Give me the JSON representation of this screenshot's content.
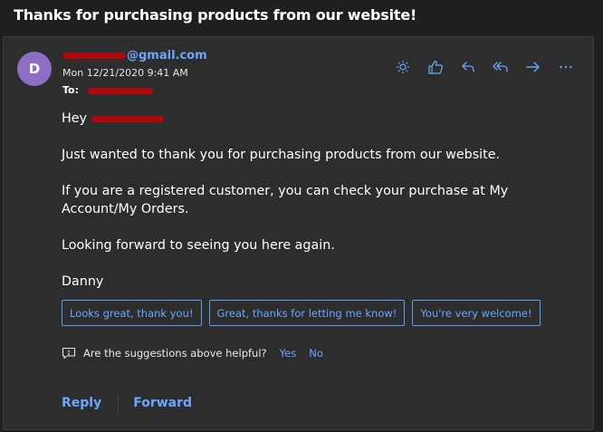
{
  "subject": "Thanks for purchasing products from our website!",
  "sender": {
    "avatar_initial": "D",
    "email_suffix": "@gmail.com",
    "date": "Mon 12/21/2020 9:41 AM",
    "to_label": "To:"
  },
  "toolbar_icons": [
    "sun-icon",
    "thumbs-up-icon",
    "reply-icon",
    "reply-all-icon",
    "forward-icon",
    "more-icon"
  ],
  "body": {
    "greeting": "Hey",
    "line1": "Just wanted to thank you for purchasing products from our website.",
    "line2": "If you are a registered customer, you can check your purchase at My Account/My Orders.",
    "line3": "Looking forward to seeing you here again.",
    "signature": "Danny"
  },
  "suggestions": [
    "Looks great, thank you!",
    "Great, thanks for letting me know!",
    "You're very welcome!"
  ],
  "feedback": {
    "question": "Are the suggestions above helpful?",
    "yes": "Yes",
    "no": "No"
  },
  "actions": {
    "reply": "Reply",
    "forward": "Forward"
  },
  "colors": {
    "background": "#1f1f1f",
    "card": "#2d2d2d",
    "accent": "#6aa8ff",
    "avatar": "#8c6fc4",
    "redaction": "#b1080e"
  }
}
